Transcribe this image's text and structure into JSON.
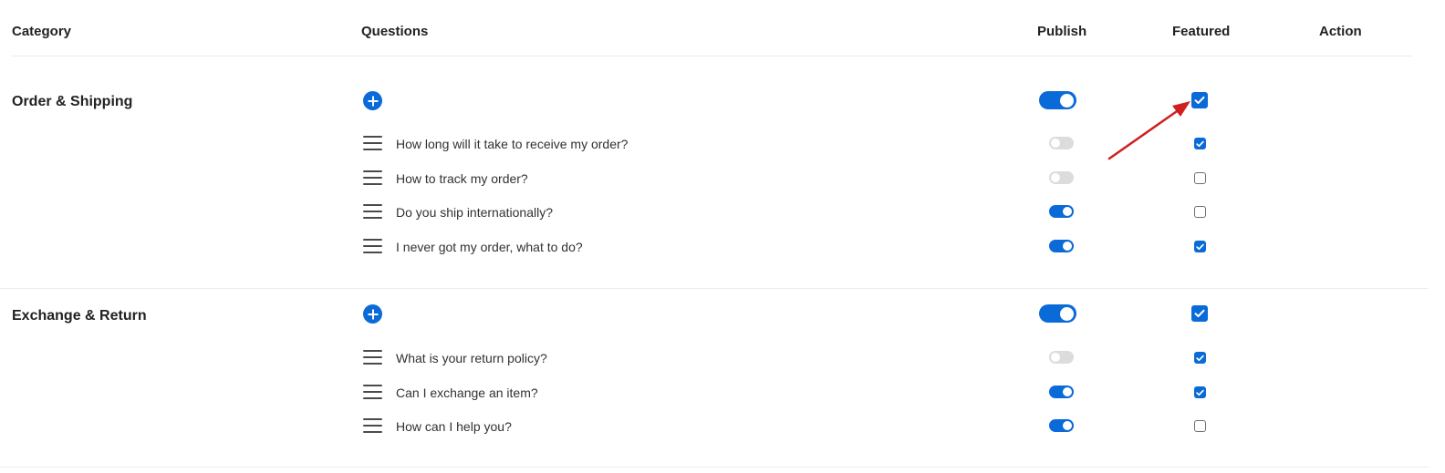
{
  "header": {
    "category": "Category",
    "questions": "Questions",
    "publish": "Publish",
    "featured": "Featured",
    "action": "Action"
  },
  "categories": [
    {
      "name": "Order & Shipping",
      "published": true,
      "featured": true,
      "questions": [
        {
          "text": "How long will it take to receive my order?",
          "published": false,
          "featured": true
        },
        {
          "text": "How to track my order?",
          "published": false,
          "featured": false
        },
        {
          "text": "Do you ship internationally?",
          "published": true,
          "featured": false
        },
        {
          "text": "I never got my order, what to do?",
          "published": true,
          "featured": true
        }
      ]
    },
    {
      "name": "Exchange & Return",
      "published": true,
      "featured": true,
      "questions": [
        {
          "text": "What is your return policy?",
          "published": false,
          "featured": true
        },
        {
          "text": "Can I exchange an item?",
          "published": true,
          "featured": true
        },
        {
          "text": "How can I help you?",
          "published": true,
          "featured": false
        }
      ]
    }
  ],
  "icons": {
    "add": "plus-circle-icon",
    "drag": "drag-handle-icon",
    "annotation": "red-arrow-icon"
  },
  "colors": {
    "accent": "#0a6bd8",
    "toggle_off": "#dcdcdc",
    "annotation_arrow": "#d01f1f",
    "divider": "#ececec"
  }
}
